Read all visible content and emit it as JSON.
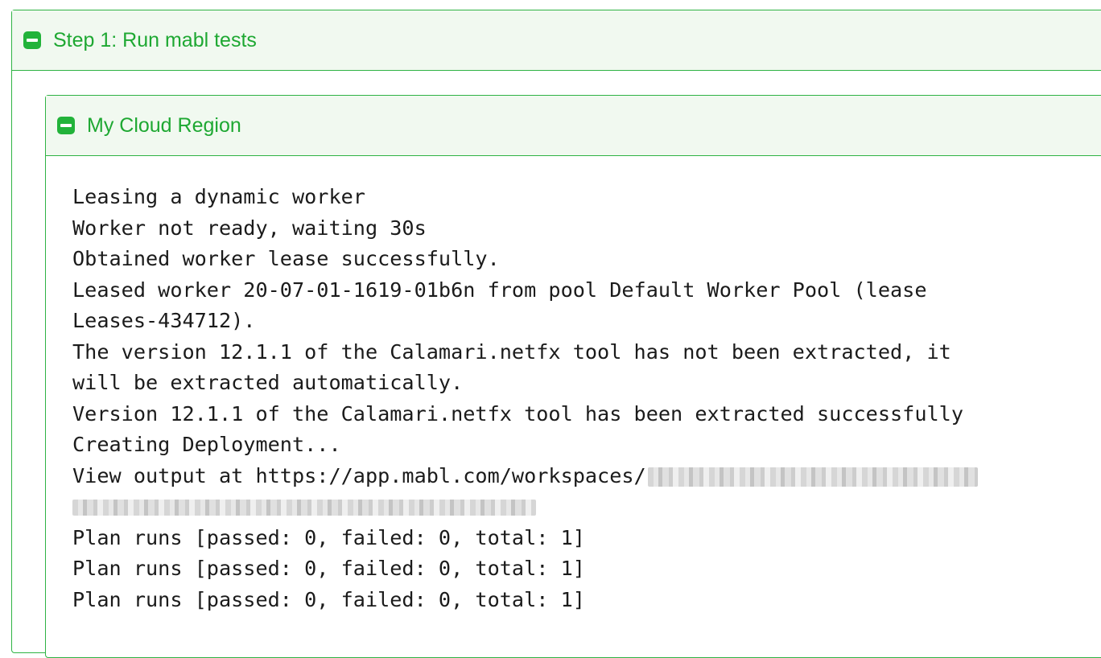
{
  "step": {
    "title": "Step 1: Run mabl tests",
    "icon": "collapse-icon"
  },
  "region": {
    "title": "My Cloud Region",
    "icon": "collapse-icon"
  },
  "log": {
    "lines": [
      "Leasing a dynamic worker",
      "Worker not ready, waiting 30s",
      "Obtained worker lease successfully.",
      "Leased worker 20-07-01-1619-01b6n from pool Default Worker Pool (lease",
      "Leases-434712).",
      "The version 12.1.1 of the Calamari.netfx tool has not been extracted, it",
      "will be extracted automatically.",
      "Version 12.1.1 of the Calamari.netfx tool has been extracted successfully",
      "Creating Deployment...",
      "View output at https://app.mabl.com/workspaces/",
      "Plan runs [passed: 0, failed: 0, total: 1]",
      "Plan runs [passed: 0, failed: 0, total: 1]",
      "Plan runs [passed: 0, failed: 0, total: 1]"
    ]
  },
  "colors": {
    "accent_green": "#22b33a",
    "header_bg": "#f1f9f0",
    "border_green": "#2fb344"
  }
}
